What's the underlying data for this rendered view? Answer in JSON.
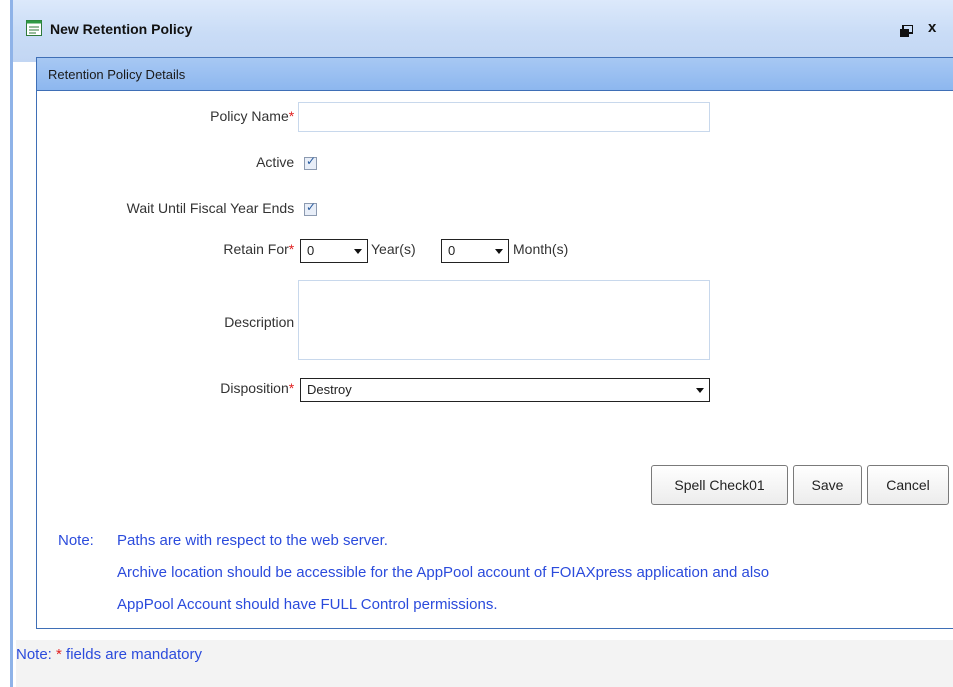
{
  "window": {
    "title": "New Retention Policy"
  },
  "panel": {
    "header": "Retention Policy Details"
  },
  "form": {
    "policy_name_label": "Policy Name",
    "policy_name_value": "",
    "active_label": "Active",
    "active_checked": true,
    "wait_label": "Wait Until Fiscal Year Ends",
    "wait_checked": true,
    "retain_label": "Retain For",
    "years_value": "0",
    "years_suffix": "Year(s)",
    "months_value": "0",
    "months_suffix": "Month(s)",
    "description_label": "Description",
    "description_value": "",
    "disposition_label": "Disposition",
    "disposition_value": "Destroy",
    "required_mark": "*",
    "separator": ":"
  },
  "buttons": {
    "spell_check": "Spell Check01",
    "save": "Save",
    "cancel": "Cancel"
  },
  "notes": {
    "prefix": "Note:",
    "line1": "Paths are with respect to the web server.",
    "line2": "Archive location should be accessible for the AppPool account of FOIAXpress application and also",
    "line3": "AppPool Account should have FULL Control permissions.",
    "footer_prefix": "Note:",
    "footer_star": "*",
    "footer_text": "fields are mandatory"
  },
  "icons": {
    "title_icon": "form-icon",
    "restore": "restore-icon",
    "close": "close-icon",
    "dropdown": "chevron-down-icon",
    "check": "checkmark-icon"
  },
  "colors": {
    "accent": "#3f6fb6",
    "note_text": "#2b4bdc",
    "required": "#e02020"
  }
}
